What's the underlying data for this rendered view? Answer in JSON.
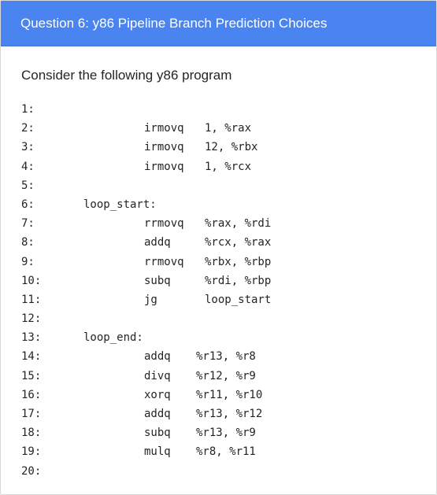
{
  "header": {
    "title": "Question 6: y86 Pipeline Branch Prediction Choices"
  },
  "prompt": "Consider the following y86 program",
  "code": {
    "lines": [
      {
        "num": "1:",
        "label": "",
        "op": "",
        "args": ""
      },
      {
        "num": "2:",
        "label": "",
        "op": "irmovq",
        "args": "1, %rax"
      },
      {
        "num": "3:",
        "label": "",
        "op": "irmovq",
        "args": "12, %rbx"
      },
      {
        "num": "4:",
        "label": "",
        "op": "irmovq",
        "args": "1, %rcx"
      },
      {
        "num": "5:",
        "label": "",
        "op": "",
        "args": ""
      },
      {
        "num": "6:",
        "label": "loop_start:",
        "op": "",
        "args": ""
      },
      {
        "num": "7:",
        "label": "",
        "op": "rrmovq",
        "args": "%rax, %rdi"
      },
      {
        "num": "8:",
        "label": "",
        "op": "addq",
        "args": "%rcx, %rax"
      },
      {
        "num": "9:",
        "label": "",
        "op": "rrmovq",
        "args": "%rbx, %rbp"
      },
      {
        "num": "10:",
        "label": "",
        "op": "subq",
        "args": "%rdi, %rbp"
      },
      {
        "num": "11:",
        "label": "",
        "op": "jg",
        "args": "loop_start"
      },
      {
        "num": "12:",
        "label": "",
        "op": "",
        "args": ""
      },
      {
        "num": "13:",
        "label": "loop_end:",
        "op": "",
        "args": ""
      },
      {
        "num": "14:",
        "label": "",
        "op": "addq",
        "args": "%r13, %r8"
      },
      {
        "num": "15:",
        "label": "",
        "op": "divq",
        "args": "%r12, %r9"
      },
      {
        "num": "16:",
        "label": "",
        "op": "xorq",
        "args": "%r11, %r10"
      },
      {
        "num": "17:",
        "label": "",
        "op": "addq",
        "args": "%r13, %r12"
      },
      {
        "num": "18:",
        "label": "",
        "op": "subq",
        "args": "%r13, %r9"
      },
      {
        "num": "19:",
        "label": "",
        "op": "mulq",
        "args": "%r8, %r11"
      },
      {
        "num": "20:",
        "label": "",
        "op": "",
        "args": ""
      }
    ]
  },
  "colors": {
    "header_bg": "#4a84f0",
    "header_text": "#ffffff",
    "body_text": "#212529"
  }
}
